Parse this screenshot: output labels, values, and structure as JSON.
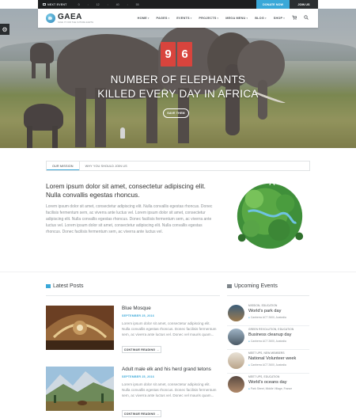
{
  "topbar": {
    "next_event_label": "NEXT EVENT",
    "counter": [
      "0",
      ":",
      "12",
      ":",
      "40",
      ":",
      "55"
    ],
    "donate_label": "DONATE NOW",
    "join_label": "JOIN US"
  },
  "nav": {
    "logo_name": "GAEA",
    "logo_tagline": "SAVE IT FOR THE FUTURE EARTH",
    "items": [
      "HOME",
      "PAGES",
      "EVENTS",
      "PROJECTS",
      "MEGA MENU",
      "BLOG",
      "SHOP"
    ]
  },
  "hero": {
    "digits": [
      "9",
      "6"
    ],
    "headline_line1": "NUMBER OF ELEPHANTS",
    "headline_line2": "KILLED EVERY DAY IN AFRICA",
    "button_label": "SAVE THEM"
  },
  "mission": {
    "tabs": [
      "OUR MISSION",
      "WHY YOU SHOULD JOIN US"
    ],
    "title": "Lorem ipsum dolor sit amet, consectetur adipiscing elit. Nulla convallis egestas rhoncus.",
    "body": "Lorem ipsum dolor sit amet, consectetur adipiscing elit. Nulla convallis egestas rhoncus. Donec facilisis fermentum sem, ac viverra ante luctus vel. Lorem ipsum dolor sit amet, consectetur adipiscing elit. Nulla convallis egestas rhoncus. Donec facilisis fermentum sem, ac viverra ante luctus vel. Lorem ipsum dolor sit amet, consectetur adipiscing elit. Nulla convallis egestas rhoncus. Donec facilisis fermentum sem, ac viverra ante luctus vel."
  },
  "latest": {
    "title": "Latest Posts",
    "posts": [
      {
        "title": "Blue Mosque",
        "date": "SEPTEMBER 25, 2016",
        "body": "Lorem ipsum dolor sit amet, consectetur adipiscing elit. Nulla convallis egestas rhoncus. Donec facilisis fermentum sem, ac viverra ante luctus vel. Donec vel mauris quam...",
        "button": "CONTINUE READING"
      },
      {
        "title": "Adult male elk and his herd grand tetons",
        "date": "SEPTEMBER 25, 2016",
        "body": "Lorem ipsum dolor sit amet, consectetur adipiscing elit. Nulla convallis egestas rhoncus. Donec facilisis fermentum sem, ac viverra ante luctus vel. Donec vel mauris quam...",
        "button": "CONTINUE READING"
      }
    ]
  },
  "events": {
    "title": "Upcoming Events",
    "items": [
      {
        "category": "MISSION, EDUCATION",
        "title": "World's park day",
        "location": "Canberra ACT 2600, Australia"
      },
      {
        "category": "GREEN REVOLUTION, EDUCATION",
        "title": "Business cleanup day",
        "location": "Canberra ACT 2600, Australia"
      },
      {
        "category": "MEET UPS, NEW MEMBERS",
        "title": "National Volunteer week",
        "location": "Canberra ACT 2600, Australia"
      },
      {
        "category": "MEET UPS, EDUCATION",
        "title": "World's oceans day",
        "location": "Park Street, Middle Village, France"
      }
    ]
  },
  "colors": {
    "accent": "#3aa8d8",
    "counter_red": "#d8443d",
    "dark": "#1d1f20"
  }
}
